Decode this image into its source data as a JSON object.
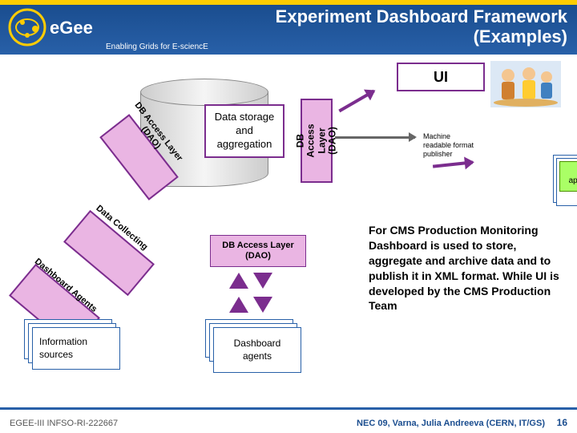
{
  "header": {
    "title_line1": "Experiment Dashboard Framework",
    "title_line2": "(Examples)",
    "subtitle": "Enabling Grids for E-sciencE",
    "logo_text": "eGee"
  },
  "diagram": {
    "ui_label": "UI",
    "storage_label": "Data storage and aggregation",
    "dao_vertical": "DB Access Layer (DAO)",
    "dao_diagonal": "DB Access Layer (DAO)",
    "machine_readable": "Machine readable format publisher",
    "other_apps": "Other applications",
    "data_collecting": "Data Collecting",
    "dashboard_agents_label": "Dashboard Agents",
    "info_sources": "Information sources",
    "dao_pink": "DB Access Layer (DAO)",
    "dashboard_agents": "Dashboard agents"
  },
  "description": "For CMS Production Monitoring  Dashboard is used to  store, aggregate and archive data and to publish it in XML format. While UI is developed by the CMS Production Team",
  "footer": {
    "left": "EGEE-III INFSO-RI-222667",
    "right": "NEC 09, Varna,  Julia Andreeva (CERN, IT/GS)",
    "page": "16"
  }
}
